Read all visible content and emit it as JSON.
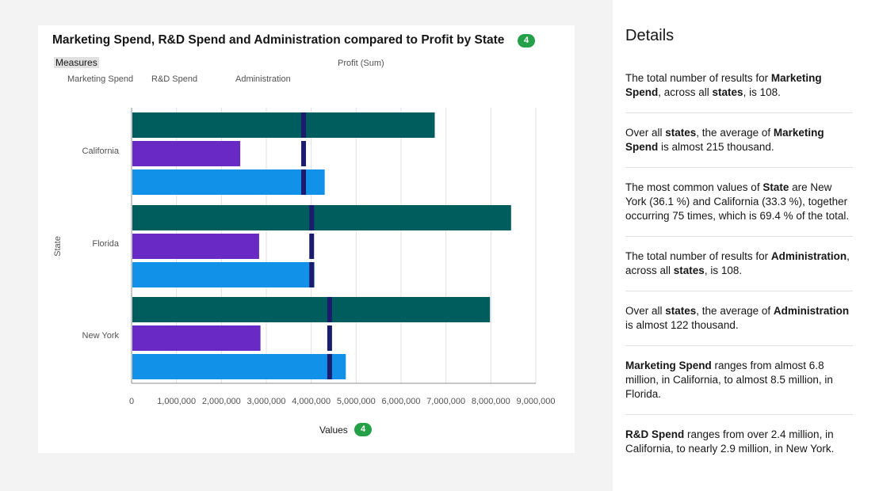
{
  "chart": {
    "title": "Marketing Spend, R&D Spend and Administration compared to Profit by State",
    "title_badge": "4",
    "measures_label": "Measures",
    "profit_label": "Profit (Sum)",
    "legend": [
      "Marketing Spend",
      "R&D Spend",
      "Administration"
    ],
    "values_label": "Values",
    "values_badge": "4"
  },
  "chart_data": {
    "type": "bar",
    "orientation": "horizontal",
    "categories": [
      "California",
      "Florida",
      "New York"
    ],
    "y_axis_label": "State",
    "x_ticks": [
      "0",
      "1,000,000",
      "2,000,000",
      "3,000,000",
      "4,000,000",
      "5,000,000",
      "6,000,000",
      "7,000,000",
      "8,000,000",
      "9,000,000"
    ],
    "xlim": [
      0,
      9000000
    ],
    "grid": true,
    "series": [
      {
        "name": "Marketing Spend",
        "color": "#005d5d",
        "values": [
          6750000,
          8450000,
          7980000
        ]
      },
      {
        "name": "R&D Spend",
        "color": "#6929c4",
        "values": [
          2420000,
          2840000,
          2870000
        ]
      },
      {
        "name": "Administration",
        "color": "#1192e8",
        "values": [
          4300000,
          4070000,
          4770000
        ]
      }
    ],
    "profit": {
      "name": "Profit (Sum)",
      "color": "#1c1c6e",
      "values": [
        3830000,
        4010000,
        4410000
      ]
    }
  },
  "details": {
    "title": "Details",
    "insights": [
      [
        {
          "t": "The total number of results for "
        },
        {
          "t": "Marketing Spend",
          "b": true
        },
        {
          "t": ", across all "
        },
        {
          "t": "states",
          "b": true
        },
        {
          "t": ", is 108."
        }
      ],
      [
        {
          "t": "Over all "
        },
        {
          "t": "states",
          "b": true
        },
        {
          "t": ", the average of "
        },
        {
          "t": "Marketing Spend",
          "b": true
        },
        {
          "t": " is almost 215 thousand."
        }
      ],
      [
        {
          "t": "The most common values of "
        },
        {
          "t": "State",
          "b": true
        },
        {
          "t": " are New York (36.1 %) and California (33.3 %), together occurring 75 times, which is 69.4 % of the total."
        }
      ],
      [
        {
          "t": "The total number of results for "
        },
        {
          "t": "Administration",
          "b": true
        },
        {
          "t": ", across all "
        },
        {
          "t": "states",
          "b": true
        },
        {
          "t": ", is 108."
        }
      ],
      [
        {
          "t": "Over all "
        },
        {
          "t": "states",
          "b": true
        },
        {
          "t": ", the average of "
        },
        {
          "t": "Administration",
          "b": true
        },
        {
          "t": " is almost 122 thousand."
        }
      ],
      [
        {
          "t": "Marketing Spend",
          "b": true
        },
        {
          "t": " ranges from almost 6.8 million, in California, to almost 8.5 million, in Florida."
        }
      ],
      [
        {
          "t": "R&D Spend",
          "b": true
        },
        {
          "t": " ranges from over 2.4 million, in California, to nearly 2.9 million, in New York."
        }
      ]
    ]
  }
}
